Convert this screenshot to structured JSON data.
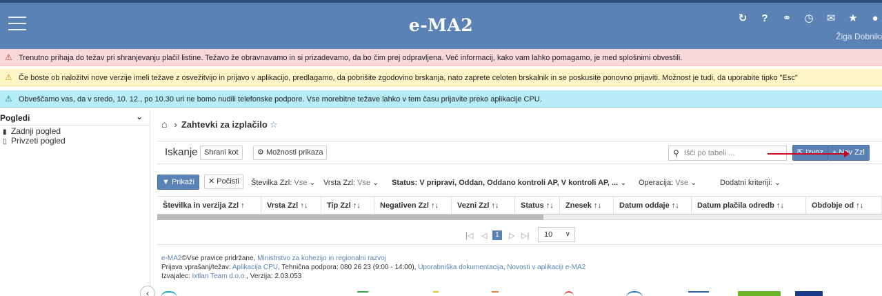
{
  "header": {
    "title": "e-MA2",
    "user_name": "Žiga Dobnikar",
    "icons": [
      "refresh-icon",
      "help-icon",
      "link-icon",
      "clock-icon",
      "envelope-icon",
      "star-icon",
      "user-icon"
    ],
    "bg_color": "#5a82b4"
  },
  "alerts": [
    {
      "type": "danger",
      "text": "Trenutno prihaja do težav pri shranjevanju plačil listine. Težavo že obravnavamo in si prizadevamo, da bo čim prej odpravljena. Več informacij, kako vam lahko pomagamo, je med splošnimi obvestili.",
      "color": "#f8d7da"
    },
    {
      "type": "warning",
      "text": "Če boste ob naložitvi nove verzije imeli težave z osvežitvijo in prijavo v aplikacijo, predlagamo, da pobrišite zgodovino brskanja, nato zaprete celoten brskalnik in se poskusite ponovno prijaviti. Možnost je tudi, da uporabite tipko \"Esc\"",
      "color": "#fff6c8"
    },
    {
      "type": "info",
      "text": "Obveščamo vas, da v sredo, 10. 12., po 10.30 uri ne bomo nudili telefonske podpore. Vse morebitne težave lahko v tem času prijavite preko aplikacije CPU.",
      "color": "#b6ecf7"
    }
  ],
  "sidebar": {
    "title": "Pogledi",
    "items": [
      {
        "label": "Zadnji pogled"
      },
      {
        "label": "Privzeti pogled"
      }
    ]
  },
  "breadcrumb": {
    "title": "Zahtevki za izplačilo"
  },
  "toolbar": {
    "search_label": "Iskanje",
    "save_label": "Shrani kot",
    "options_label": "Možnosti prikaza",
    "search_placeholder": "Išči po tabeli ...",
    "export_label": "Izvoz",
    "new_label": "Nov Zzl"
  },
  "filters": {
    "show_label": "Prikaži",
    "clear_label": "Počisti",
    "number_label": "Številka Zzl:",
    "number_value": "Vse",
    "type_label": "Vrsta Zzl:",
    "type_value": "Vse",
    "status_text": "Status: V pripravi, Oddan, Oddano kontroli AP, V kontroli AP, ...",
    "operation_label": "Operacija:",
    "operation_value": "Vse",
    "extra_label": "Dodatni kriteriji:"
  },
  "table": {
    "columns": [
      "Številka in verzija Zzl",
      "Vrsta Zzl",
      "Tip Zzl",
      "Negativen Zzl",
      "Vezni Zzl",
      "Status",
      "Znesek",
      "Datum oddaje",
      "Datum plačila odredb",
      "Obdobje od"
    ]
  },
  "pager": {
    "current_page": "1",
    "page_size": "10"
  },
  "footer": {
    "app": "e-MA2",
    "rights": "Vse pravice pridržane,",
    "ministry": "Ministrstvo za kohezijo in regionalni razvoj",
    "report_prefix": "Prijava vprašanj/težav:",
    "cpu_link": "Aplikacija CPU",
    "support_text": ", Tehnična podpora: 080 26 23 (9:00 - 14:00),",
    "docs_link": "Uporabniška dokumentacija",
    "news_link": "Novosti v aplikaciji e-MA2",
    "contractor_prefix": "Izvajalec:",
    "contractor_link": "Ixtlan Team d.o.o.",
    "version": ", Verzija: 2.03.053"
  }
}
